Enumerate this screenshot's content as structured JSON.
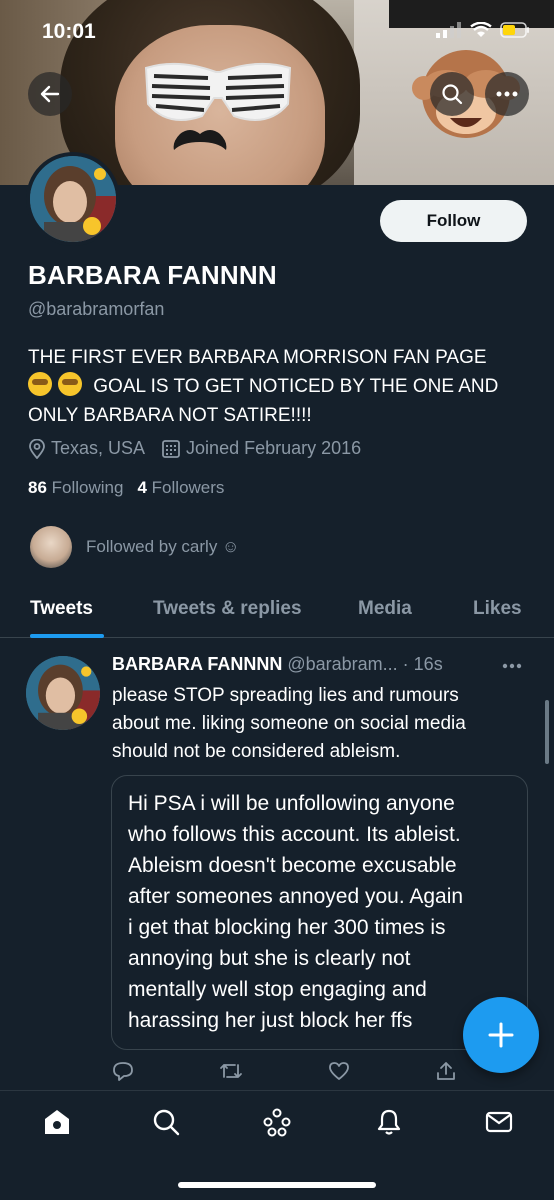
{
  "status_bar": {
    "time": "10:01"
  },
  "profile": {
    "display_name": "BARBARA FANNNN",
    "handle": "@barabramorfan",
    "bio_line1": "THE FIRST EVER BARBARA MORRISON FAN PAGE",
    "bio_line2": "GOAL IS TO GET NOTICED BY THE ONE AND",
    "bio_line3": "ONLY BARBARA NOT SATIRE!!!!",
    "location": "Texas, USA",
    "joined": "Joined February 2016",
    "following_count": "86",
    "following_label": "Following",
    "followers_count": "4",
    "followers_label": "Followers",
    "followed_by": "Followed by carly ☺",
    "follow_button": "Follow"
  },
  "tabs": [
    {
      "label": "Tweets",
      "active": true
    },
    {
      "label": "Tweets & replies",
      "active": false
    },
    {
      "label": "Media",
      "active": false
    },
    {
      "label": "Likes",
      "active": false
    }
  ],
  "tweet": {
    "author": "BARBARA FANNNN",
    "handle": "@barabram...",
    "time": "· 16s",
    "text_line1": "please STOP spreading lies and rumours",
    "text_line2": "about me. liking someone on social media",
    "text_line3": "should not be considered ableism.",
    "quote_lines": [
      "Hi PSA i will be unfollowing anyone",
      "who follows this account. Its ableist.",
      "Ableism doesn't become excusable",
      "after someones annoyed you. Again",
      "i get that blocking her 300 times is",
      "annoying but she is clearly not",
      "mentally well stop engaging and",
      "harassing her just block her ffs"
    ]
  },
  "colors": {
    "background": "#15202b",
    "accent": "#1d9bf0",
    "muted": "#8b98a5",
    "divider": "#38444d"
  },
  "icons": [
    "back-arrow-icon",
    "search-icon",
    "more-icon",
    "location-icon",
    "calendar-icon",
    "reply-icon",
    "retweet-icon",
    "like-icon",
    "share-icon",
    "compose-icon",
    "home-icon",
    "explore-icon",
    "spaces-icon",
    "notifications-icon",
    "messages-icon"
  ]
}
